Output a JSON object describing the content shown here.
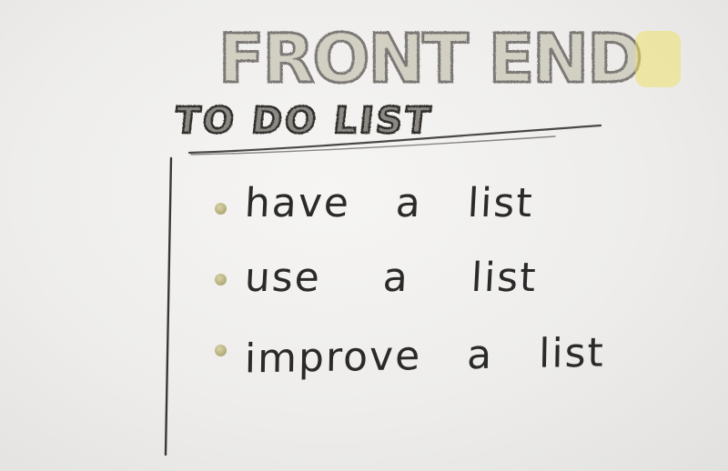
{
  "heading": {
    "front_end": "FRONT END",
    "to_do_list": "TO DO LIST"
  },
  "list": {
    "items": [
      {
        "label": "have a list"
      },
      {
        "label": "use a list"
      },
      {
        "label": "improve a list"
      }
    ]
  },
  "colors": {
    "paper": "#eeedeb",
    "ink": "#2b2a2a",
    "outline_letters": "#6e6c6a",
    "front_fill": "#c7c2a4",
    "end_d_fill": "#ece06a",
    "bullet": "#b8b07e"
  }
}
